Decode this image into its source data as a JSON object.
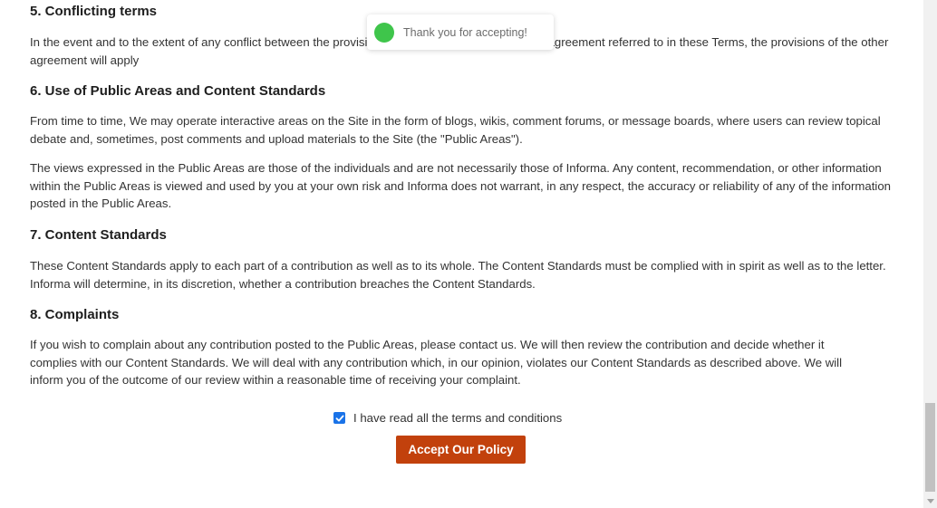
{
  "sections": [
    {
      "title": "5. Conflicting terms",
      "paragraphs": [
        "In the event and to the extent of any conflict between the provisions of these Terms and any other agreement referred to in these Terms, the provisions of the other agreement will apply"
      ]
    },
    {
      "title": "6. Use of Public Areas and Content Standards",
      "paragraphs": [
        "From time to time, We may operate interactive areas on the Site in the form of blogs, wikis, comment forums, or message boards, where users can review topical debate and, sometimes, post comments and upload materials to the Site (the \"Public Areas\").",
        "The views expressed in the Public Areas are those of the individuals and are not necessarily those of Informa. Any content, recommendation, or other information within the Public Areas is viewed and used by you at your own risk and Informa does not warrant, in any respect, the accuracy or reliability of any of the information posted in the Public Areas."
      ]
    },
    {
      "title": "7. Content Standards",
      "paragraphs": [
        "These Content Standards apply to each part of a contribution as well as to its whole. The Content Standards must be complied with in spirit as well as to the letter. Informa will determine, in its discretion, whether a contribution breaches the Content Standards."
      ]
    },
    {
      "title": "8. Complaints",
      "paragraphs": [
        "If you wish to complain about any contribution posted to the Public Areas, please contact us. We will then review the contribution and decide whether it complies with our Content Standards. We will deal with any contribution which, in our opinion, violates our Content Standards as described above. We will inform you of the outcome of our review within a reasonable time of receiving your complaint."
      ]
    }
  ],
  "acceptance": {
    "checkbox_checked": true,
    "checkbox_label": "I have read all the terms and conditions",
    "button_label": "Accept Our Policy",
    "button_color": "#c2410c",
    "checkbox_color": "#1a73e8"
  },
  "toast": {
    "message": "Thank you for accepting!",
    "indicator_color": "#3fc54b",
    "icon": "success-dot-icon"
  },
  "scrollbar": {
    "icon": "scroll-down-arrow-icon"
  }
}
